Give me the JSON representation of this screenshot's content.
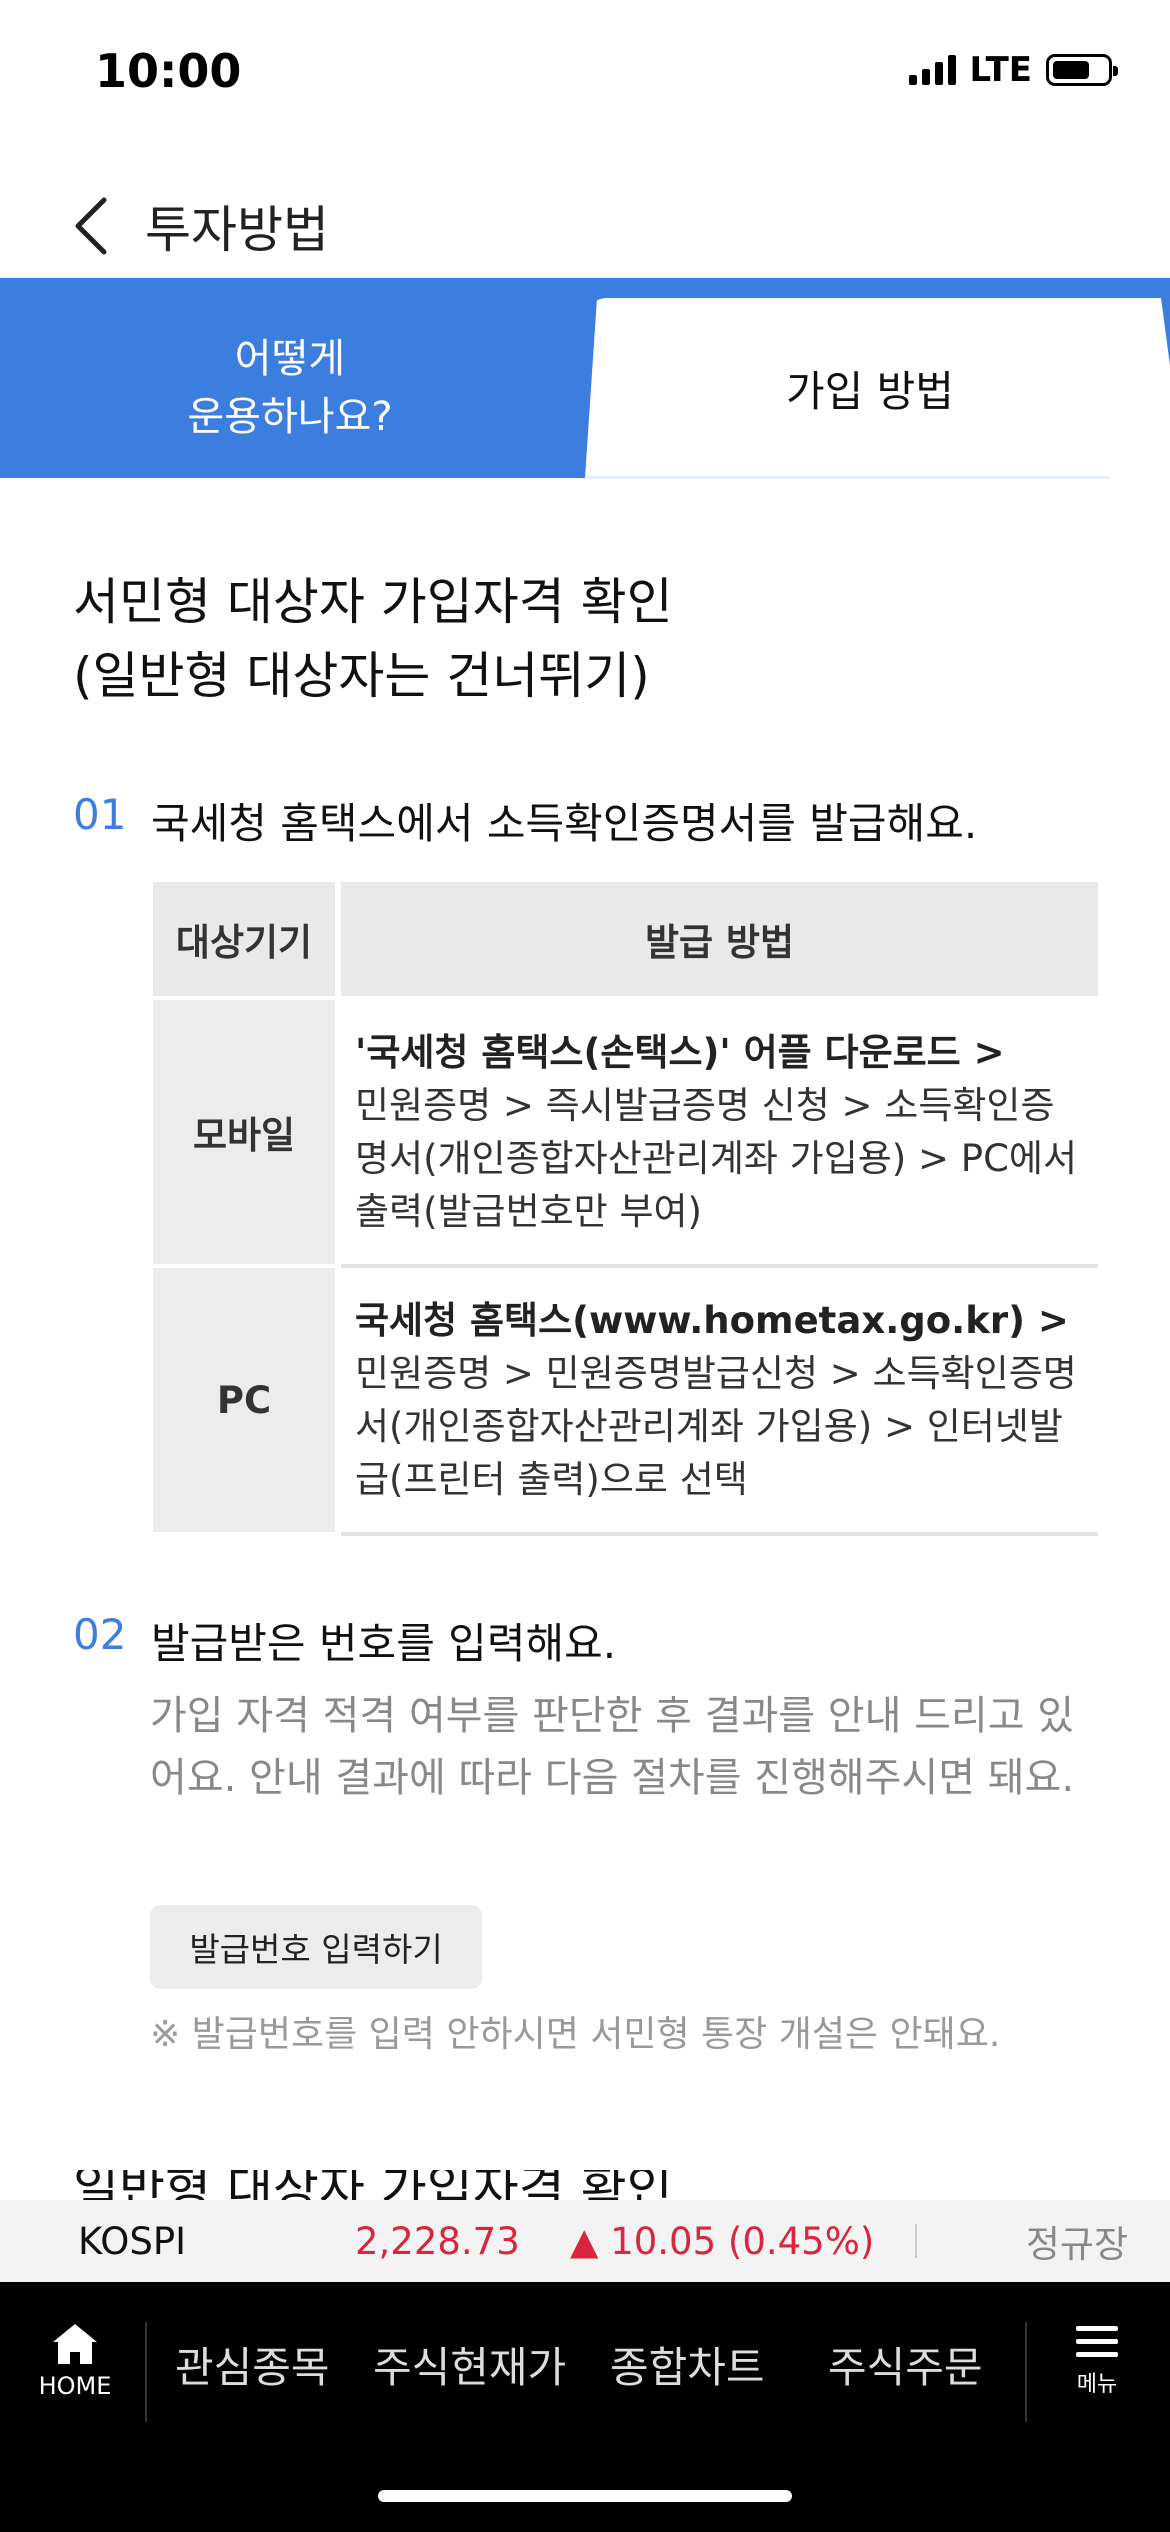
{
  "status_bar": {
    "time": "10:00",
    "network": "LTE"
  },
  "header": {
    "title": "투자방법",
    "back_icon": "chevron-left-icon"
  },
  "tabs": [
    {
      "label": "어떻게\n운용하나요?",
      "active": false
    },
    {
      "label": "가입 방법",
      "active": true
    }
  ],
  "colors": {
    "accent": "#3c7ee0",
    "price_up": "#d7263d",
    "nav_bg": "#000000"
  },
  "section": {
    "title": "서민형 대상자 가입자격 확인\n(일반형 대상자는 건너뛰기)"
  },
  "steps": [
    {
      "number": "01",
      "text": "국세청 홈택스에서 소득확인증명서를 발급해요."
    },
    {
      "number": "02",
      "text": "발급받은 번호를 입력해요.",
      "description": "가입 자격 적격 여부를 판단한 후 결과를 안내 드리고 있어요. 안내 결과에 따라 다음 절차를 진행해주시면 돼요."
    }
  ],
  "issue_table": {
    "headers": [
      "대상기기",
      "발급 방법"
    ],
    "rows": [
      {
        "device": "모바일",
        "method_bold": "'국세청 홈택스(손택스)' 어플 다운로드 >",
        "method_rest": "민원증명 > 즉시발급증명 신청 > 소득확인증명서(개인종합자산관리계좌 가입용) > PC에서 출력(발급번호만 부여)"
      },
      {
        "device": "PC",
        "method_bold": "국세청 홈택스(www.hometax.go.kr) >",
        "method_rest": "민원증명 > 민원증명발급신청 > 소득확인증명서(개인종합자산관리계좌 가입용) > 인터넷발급(프린터 출력)으로 선택"
      }
    ]
  },
  "issue_button_label": "발급번호 입력하기",
  "note": "※ 발급번호를 입력 안하시면 서민형 통장 개설은 안돼요.",
  "next_heading_partial": "일반형 대상자 가입자격 확인",
  "ticker": {
    "index_name": "KOSPI",
    "value": "2,228.73",
    "change": "▲ 10.05 (0.45%)",
    "session": "정규장"
  },
  "bottom_nav": {
    "home_label": "HOME",
    "items": [
      "관심종목",
      "주식현재가",
      "종합차트",
      "주식주문"
    ],
    "menu_label": "메뉴"
  }
}
